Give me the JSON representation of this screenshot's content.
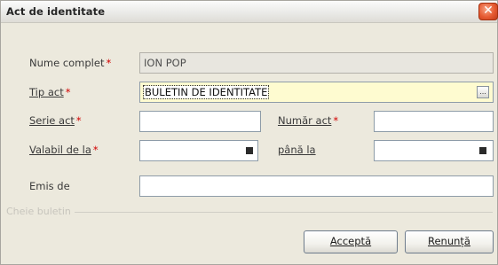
{
  "window": {
    "title": "Act de identitate",
    "close_glyph": "✕"
  },
  "fields": {
    "full_name": {
      "label": "Nume complet",
      "required_mark": "*",
      "value": "ION POP"
    },
    "act_type": {
      "label": "Tip act",
      "required_mark": "*",
      "value": "BULETIN DE IDENTITATE",
      "picker_glyph": "..."
    },
    "series": {
      "label": "Serie act",
      "required_mark": "*",
      "value": ""
    },
    "number": {
      "label": "Număr act",
      "required_mark": "*",
      "value": ""
    },
    "valid_from": {
      "label": "Valabil de la",
      "required_mark": "*",
      "value": ""
    },
    "valid_to": {
      "label": "până la",
      "value": ""
    },
    "issued_by": {
      "label": "Emis de",
      "value": ""
    }
  },
  "section": {
    "label": "Cheie buletin"
  },
  "buttons": {
    "accept": "Acceptă",
    "cancel": "Renunță"
  },
  "colors": {
    "required": "#d20000",
    "highlight_field": "#fefbd0",
    "close_button": "#e65a31"
  }
}
